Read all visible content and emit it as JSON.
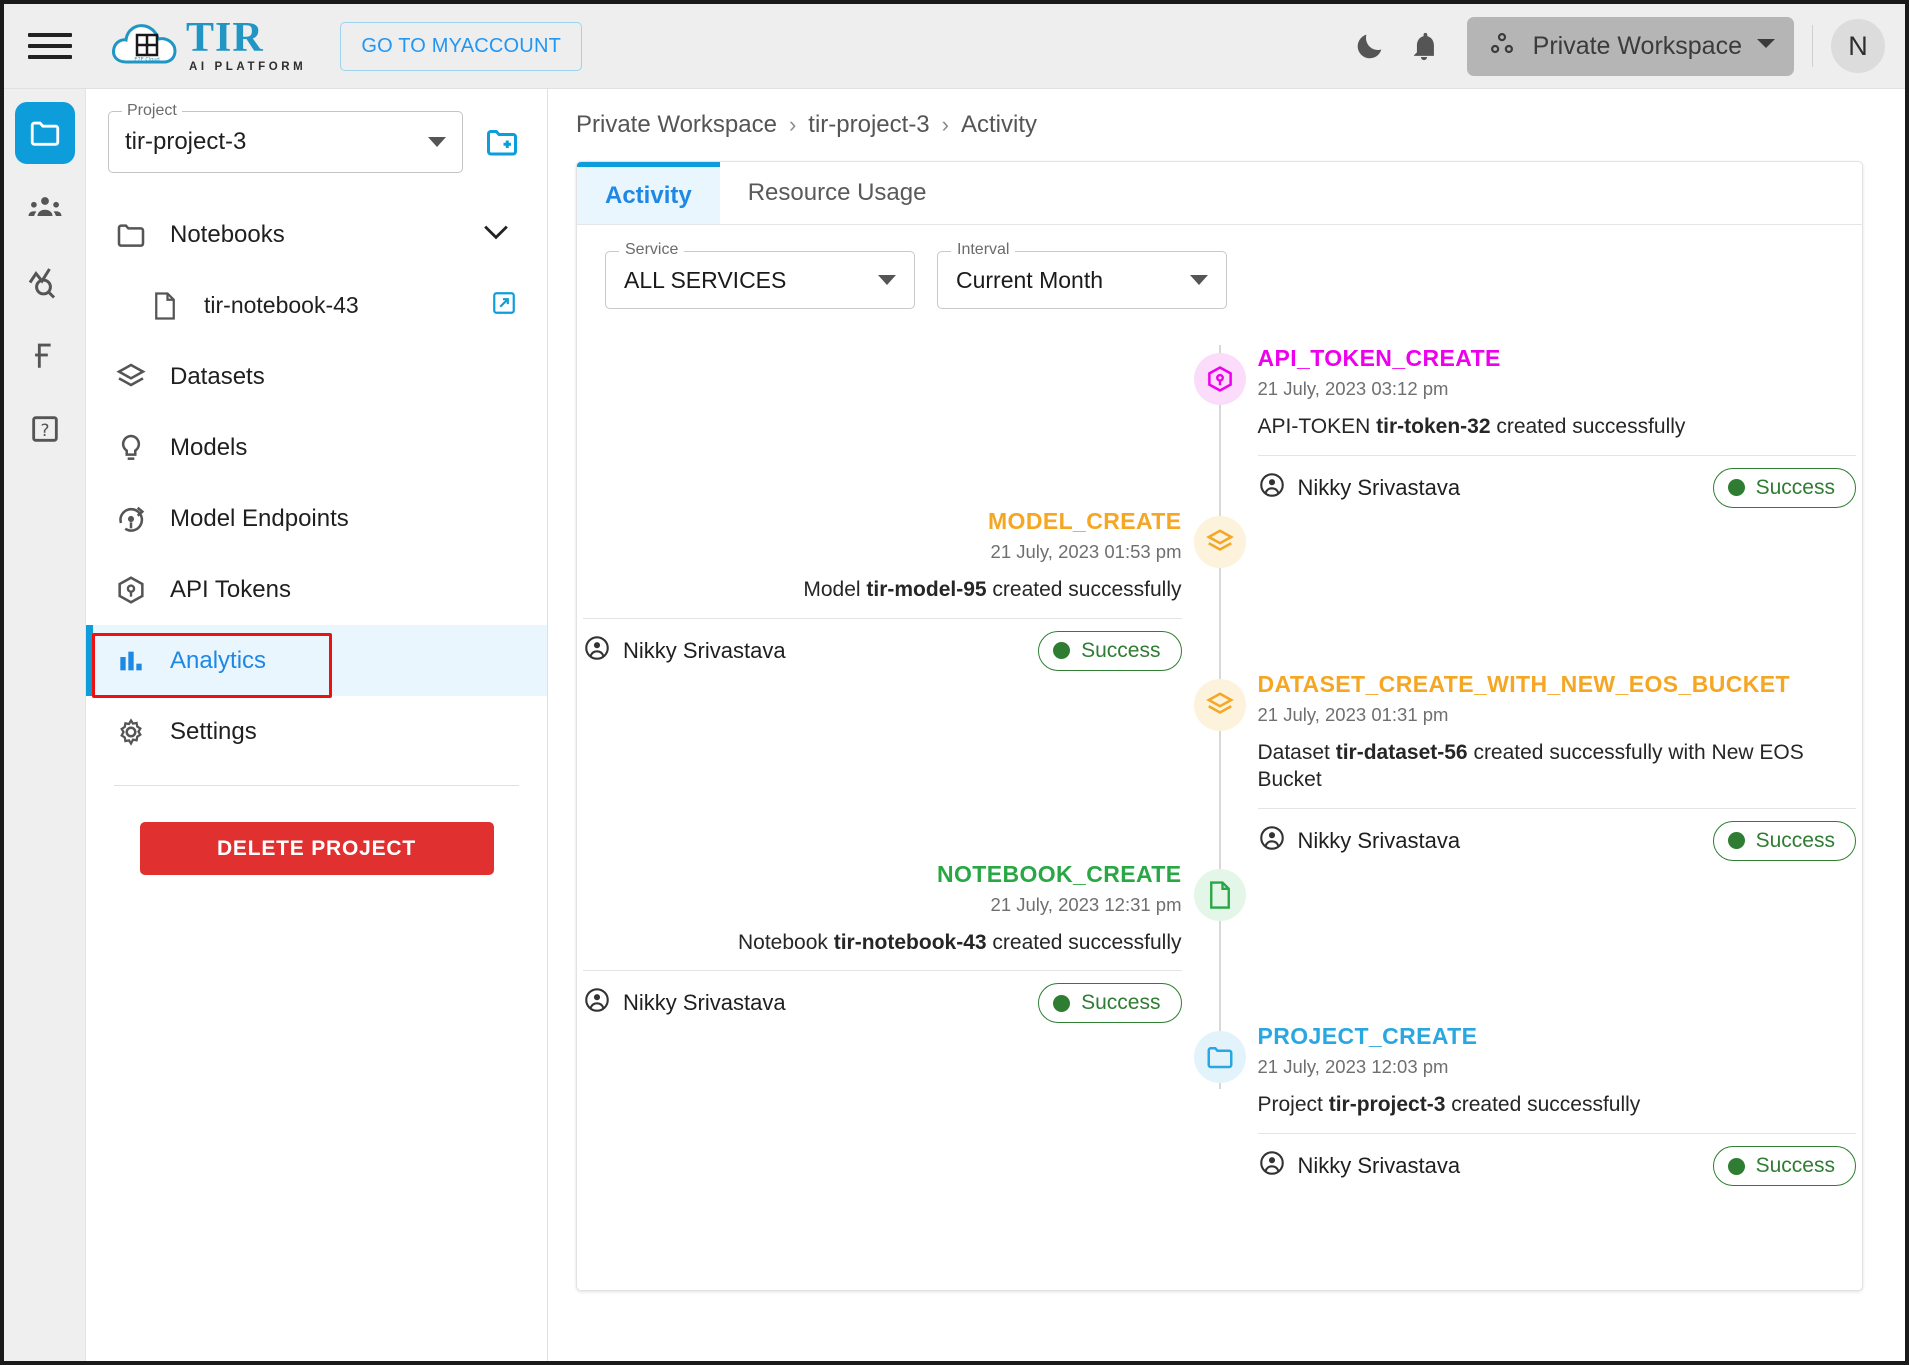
{
  "topbar": {
    "menu_icon": "hamburger-icon",
    "brand_title": "TIR",
    "brand_subtitle": "AI PLATFORM",
    "myaccount_label": "GO TO MYACCOUNT",
    "theme_icon": "moon-icon",
    "notifications_icon": "bell-icon",
    "workspace_label": "Private Workspace",
    "workspace_icon": "workspace-icon",
    "avatar_initial": "N"
  },
  "rail": {
    "items": [
      {
        "icon": "folder-icon",
        "name": "projects",
        "active": true
      },
      {
        "icon": "team-icon",
        "name": "team",
        "active": false
      },
      {
        "icon": "monitoring-icon",
        "name": "monitoring",
        "active": false
      },
      {
        "icon": "billing-icon",
        "name": "billing",
        "active": false
      },
      {
        "icon": "help-icon",
        "name": "help",
        "active": false
      }
    ]
  },
  "sidebar": {
    "project_label": "Project",
    "project_value": "tir-project-3",
    "new_project_icon": "new-folder-icon",
    "items": [
      {
        "label": "Notebooks",
        "icon": "folder-icon",
        "type": "group",
        "expanded": true
      },
      {
        "label": "tir-notebook-43",
        "icon": "file-icon",
        "type": "child",
        "external": true
      },
      {
        "label": "Datasets",
        "icon": "layers-icon",
        "type": "item"
      },
      {
        "label": "Models",
        "icon": "bulb-icon",
        "type": "item"
      },
      {
        "label": "Model Endpoints",
        "icon": "endpoint-icon",
        "type": "item"
      },
      {
        "label": "API Tokens",
        "icon": "cube-icon",
        "type": "item"
      },
      {
        "label": "Analytics",
        "icon": "bar-chart-icon",
        "type": "item",
        "selected": true
      },
      {
        "label": "Settings",
        "icon": "gear-icon",
        "type": "item"
      }
    ],
    "delete_button": "DELETE PROJECT"
  },
  "breadcrumb": {
    "items": [
      "Private Workspace",
      "tir-project-3",
      "Activity"
    ],
    "separator": "›"
  },
  "main": {
    "tabs": [
      {
        "label": "Activity",
        "active": true
      },
      {
        "label": "Resource Usage",
        "active": false
      }
    ],
    "filters": {
      "service_label": "Service",
      "service_value": "ALL SERVICES",
      "interval_label": "Interval",
      "interval_value": "Current Month"
    }
  },
  "colors": {
    "accent": "#0d9ddb",
    "link": "#1e88e5",
    "danger": "#e03030",
    "success": "#2e7d32",
    "magenta": "#ee00ee",
    "orange": "#f5a623",
    "green": "#29a745",
    "blue": "#29a7e0"
  },
  "activity": [
    {
      "side": "right",
      "type": "API_TOKEN_CREATE",
      "icon": "cube-icon",
      "color": "#ee00ee",
      "bg": "#fbdcfb",
      "time": "21 July, 2023 03:12 pm",
      "desc_prefix": "API-TOKEN ",
      "desc_bold": "tir-token-32",
      "desc_suffix": " created successfully",
      "user": "Nikky Srivastava",
      "status": "Success"
    },
    {
      "side": "left",
      "type": "MODEL_CREATE",
      "icon": "layers-icon",
      "color": "#f5a623",
      "bg": "#fdf2dc",
      "time": "21 July, 2023 01:53 pm",
      "desc_prefix": "Model ",
      "desc_bold": "tir-model-95",
      "desc_suffix": " created successfully",
      "user": "Nikky Srivastava",
      "status": "Success"
    },
    {
      "side": "right",
      "type": "DATASET_CREATE_WITH_NEW_EOS_BUCKET",
      "icon": "layers-icon",
      "color": "#f5a623",
      "bg": "#fdf2dc",
      "time": "21 July, 2023 01:31 pm",
      "desc_prefix": "Dataset ",
      "desc_bold": "tir-dataset-56",
      "desc_suffix": " created successfully with New EOS Bucket",
      "user": "Nikky Srivastava",
      "status": "Success"
    },
    {
      "side": "left",
      "type": "NOTEBOOK_CREATE",
      "icon": "file-icon",
      "color": "#29a745",
      "bg": "#e3f6e8",
      "time": "21 July, 2023 12:31 pm",
      "desc_prefix": "Notebook ",
      "desc_bold": "tir-notebook-43",
      "desc_suffix": " created successfully",
      "user": "Nikky Srivastava",
      "status": "Success"
    },
    {
      "side": "right",
      "type": "PROJECT_CREATE",
      "icon": "folder-icon",
      "color": "#29a7e0",
      "bg": "#e2f3fb",
      "time": "21 July, 2023 12:03 pm",
      "desc_prefix": "Project ",
      "desc_bold": "tir-project-3",
      "desc_suffix": " created successfully",
      "user": "Nikky Srivastava",
      "status": "Success"
    }
  ]
}
